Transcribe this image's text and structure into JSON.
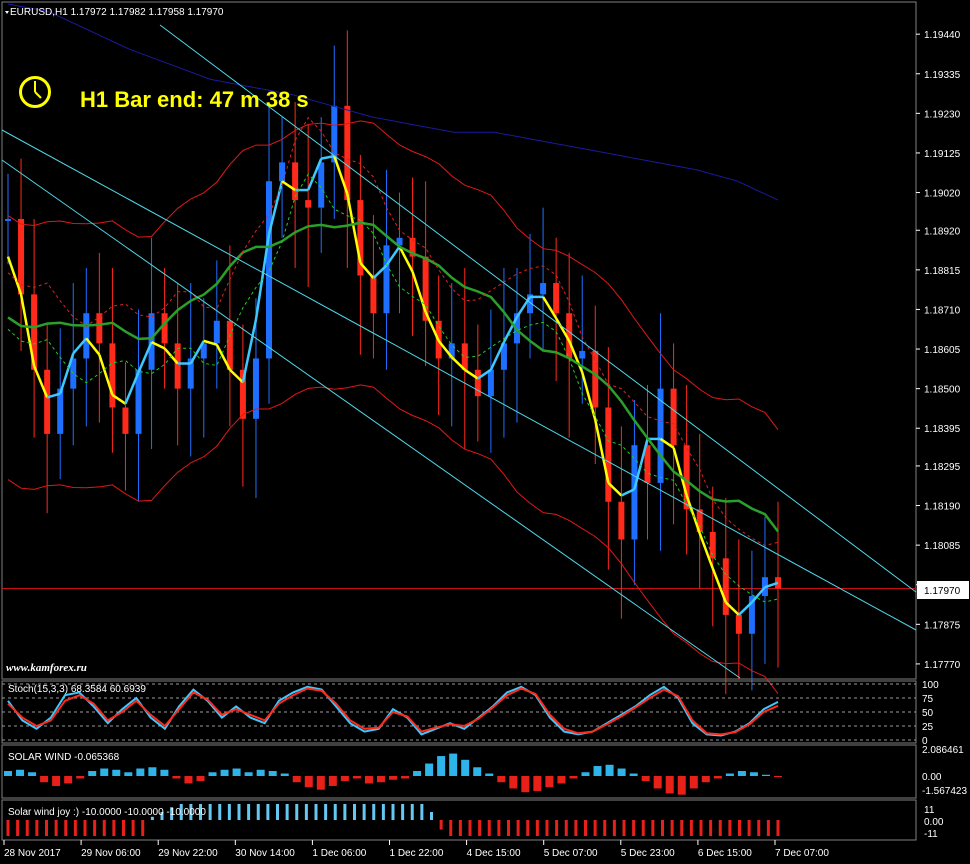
{
  "header": {
    "symbol_line": "EURUSD,H1  1.17972 1.17982 1.17958 1.17970",
    "bar_timer": "H1 Bar end: 47 m 38 s",
    "watermark": "www.kamforex.ru"
  },
  "colors": {
    "bull": "#1e6fff",
    "bear": "#ff2a1a",
    "yellow": "#ffff00",
    "cyan": "#3ec8ff",
    "green": "#2aa02a",
    "red_band": "#e01818",
    "blue_band": "#1a1aa0",
    "current_price": "#c81010"
  },
  "chart_data": [
    {
      "type": "line",
      "name": "main",
      "instrument": "EURUSD",
      "timeframe": "H1",
      "ohlc_last": {
        "open": 1.17972,
        "high": 1.17982,
        "low": 1.17958,
        "close": 1.1797
      },
      "ylim": [
        1.1773,
        1.1952
      ],
      "y_ticks": [
        "1.19440",
        "1.19335",
        "1.19230",
        "1.19125",
        "1.19020",
        "1.18920",
        "1.18815",
        "1.18710",
        "1.18605",
        "1.18500",
        "1.18395",
        "1.18295",
        "1.18190",
        "1.18085",
        "1.17980",
        "1.17875",
        "1.17770"
      ],
      "x_ticks": [
        "28 Nov 2017",
        "29 Nov 06:00",
        "29 Nov 22:00",
        "30 Nov 14:00",
        "1 Dec 06:00",
        "1 Dec 22:00",
        "4 Dec 15:00",
        "5 Dec 07:00",
        "5 Dec 23:00",
        "6 Dec 15:00",
        "7 Dec 07:00"
      ],
      "current_price": "1.17970",
      "series": [
        {
          "name": "close",
          "values": [
            1.1895,
            1.1875,
            1.1855,
            1.1838,
            1.185,
            1.1858,
            1.187,
            1.1862,
            1.1845,
            1.1838,
            1.1855,
            1.187,
            1.1862,
            1.185,
            1.1858,
            1.1862,
            1.1868,
            1.1855,
            1.1842,
            1.1858,
            1.1905,
            1.191,
            1.19,
            1.1898,
            1.191,
            1.1925,
            1.19,
            1.188,
            1.187,
            1.1888,
            1.189,
            1.1885,
            1.1868,
            1.1858,
            1.1862,
            1.1855,
            1.1848,
            1.1855,
            1.1862,
            1.187,
            1.1875,
            1.1878,
            1.187,
            1.1858,
            1.186,
            1.1845,
            1.182,
            1.181,
            1.1835,
            1.1825,
            1.185,
            1.1835,
            1.1818,
            1.1812,
            1.1805,
            1.179,
            1.1785,
            1.1795,
            1.18,
            1.1797
          ]
        },
        {
          "name": "upper_band",
          "values": [
            1.1952,
            1.195,
            1.1945,
            1.194,
            1.1936,
            1.1932,
            1.193,
            1.1928,
            1.1925,
            1.1922,
            1.192,
            1.1918,
            1.1918,
            1.1916,
            1.1914,
            1.1912,
            1.191,
            1.1908,
            1.1905,
            1.19
          ]
        }
      ]
    },
    {
      "type": "line",
      "name": "stochastic",
      "legend": "Stoch(15,3,3) 68.3584 60.6939",
      "levels": [
        "100",
        "75",
        "50",
        "25",
        "0"
      ],
      "series": [
        {
          "name": "%K",
          "values": [
            70,
            35,
            20,
            40,
            80,
            85,
            60,
            30,
            55,
            75,
            40,
            20,
            60,
            90,
            70,
            40,
            60,
            40,
            30,
            70,
            85,
            95,
            90,
            60,
            30,
            15,
            20,
            55,
            40,
            10,
            20,
            30,
            20,
            40,
            60,
            85,
            95,
            80,
            40,
            15,
            10,
            15,
            30,
            45,
            60,
            80,
            95,
            75,
            30,
            10,
            8,
            15,
            30,
            55,
            68
          ]
        },
        {
          "name": "%D",
          "values": [
            65,
            40,
            25,
            35,
            70,
            80,
            65,
            35,
            50,
            70,
            45,
            25,
            55,
            85,
            72,
            45,
            55,
            45,
            35,
            65,
            80,
            92,
            88,
            65,
            35,
            20,
            22,
            50,
            42,
            15,
            22,
            28,
            25,
            38,
            58,
            80,
            92,
            82,
            45,
            20,
            12,
            15,
            28,
            42,
            58,
            75,
            90,
            78,
            35,
            12,
            10,
            14,
            28,
            50,
            61
          ]
        }
      ]
    },
    {
      "type": "bar",
      "name": "solar_wind",
      "legend": "SOLAR WIND -0.065368",
      "y_ticks": [
        "2.086461",
        "0.00",
        "-1.567423"
      ],
      "values": [
        0.4,
        0.5,
        0.3,
        -0.5,
        -0.8,
        -0.6,
        -0.2,
        0.4,
        0.6,
        0.5,
        0.3,
        0.6,
        0.7,
        0.5,
        -0.2,
        -0.6,
        -0.4,
        0.3,
        0.5,
        0.6,
        0.3,
        0.5,
        0.4,
        0.2,
        -0.5,
        -0.9,
        -1.1,
        -0.8,
        -0.4,
        -0.2,
        -0.6,
        -0.5,
        -0.3,
        -0.2,
        0.4,
        1.0,
        1.6,
        1.8,
        1.3,
        0.7,
        0.2,
        -0.5,
        -1.0,
        -1.3,
        -1.2,
        -0.9,
        -0.6,
        -0.2,
        0.3,
        0.8,
        0.9,
        0.6,
        0.2,
        -0.4,
        -1.0,
        -1.4,
        -1.5,
        -1.0,
        -0.5,
        -0.2,
        0.2,
        0.4,
        0.3,
        0.1,
        -0.07
      ]
    },
    {
      "type": "bar",
      "name": "solar_wind_joy",
      "legend": "Solar wind joy :) -10.0000 -10.0000 -10.0000",
      "y_ticks": [
        "11",
        "0.00",
        "-11"
      ],
      "values": [
        -10,
        -10,
        -10,
        -10,
        -10,
        -10,
        -10,
        -10,
        -10,
        -10,
        -10,
        -10,
        -10,
        -10,
        -10,
        2,
        5,
        8,
        10,
        10,
        10,
        10,
        10,
        10,
        10,
        10,
        10,
        10,
        10,
        10,
        10,
        10,
        10,
        10,
        10,
        10,
        10,
        10,
        10,
        10,
        10,
        10,
        10,
        10,
        5,
        -6,
        -10,
        -10,
        -10,
        -10,
        -10,
        -10,
        -10,
        -10,
        -10,
        -10,
        -10,
        -10,
        -10,
        -10,
        -10,
        -10,
        -10,
        -10,
        -10,
        -10,
        -10,
        -10,
        -10,
        -10,
        -10,
        -10,
        -10,
        -10,
        -10,
        -10,
        -10,
        -10,
        -10,
        -10,
        -10
      ]
    }
  ]
}
